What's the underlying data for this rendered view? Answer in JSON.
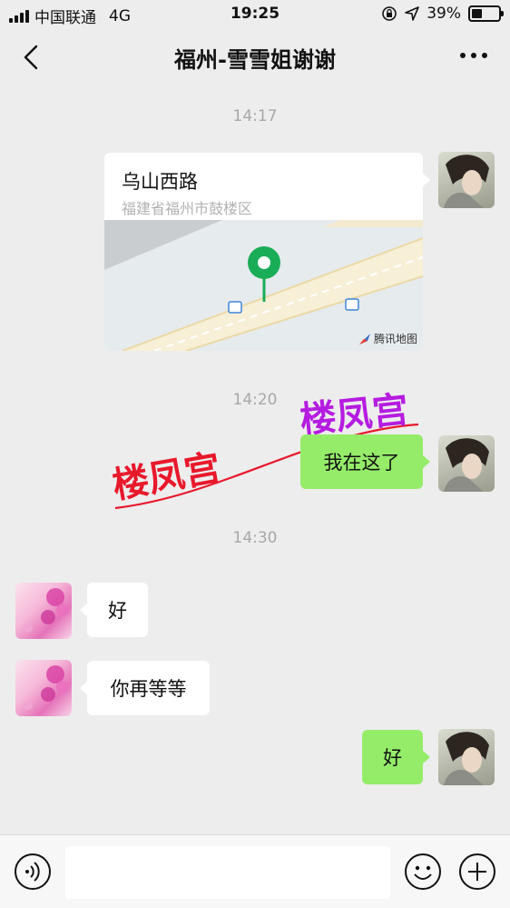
{
  "status_bar": {
    "carrier": "中国联通",
    "network": "4G",
    "time": "19:25",
    "battery_percent": "39%",
    "battery_level": 0.39,
    "icons": [
      "signal-icon",
      "lock-rotation-icon",
      "location-arrow-icon",
      "battery-icon"
    ]
  },
  "header": {
    "title": "福州-雪雪姐谢谢",
    "back_icon": "chevron-left-icon",
    "more_icon": "more-dots-icon"
  },
  "messages": {
    "ts1": "14:17",
    "location": {
      "title": "乌山西路",
      "address": "福建省福州市鼓楼区",
      "map_credit": "腾讯地图"
    },
    "ts2": "14:20",
    "msg1": "我在这了",
    "ts3": "14:30",
    "msg2": "好",
    "msg3": "你再等等",
    "msg4": "好"
  },
  "watermark": {
    "text_left": "楼凤宫",
    "text_right": "楼凤宫"
  },
  "input_bar": {
    "icons": [
      "voice-icon",
      "emoji-icon",
      "plus-icon"
    ],
    "value": ""
  },
  "colors": {
    "background": "#ededed",
    "bubble_out": "#95ec69",
    "bubble_in": "#ffffff",
    "pin": "#1aad57",
    "watermark_red": "#e8182b",
    "watermark_purple": "#b51ce0"
  }
}
